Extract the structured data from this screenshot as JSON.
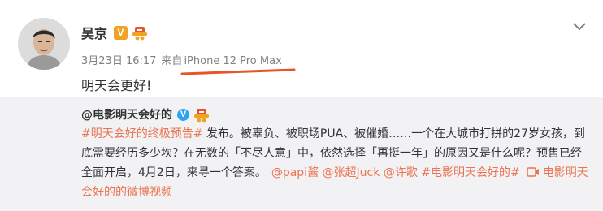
{
  "post": {
    "author": "吴京",
    "verified_badge": "V",
    "time": "3月23日 16:17",
    "source_prefix": "来自",
    "source": "iPhone 12 Pro Max",
    "text": "明天会更好!"
  },
  "repost": {
    "author": "@电影明天会好的",
    "verified_badge": "V",
    "hashtag": "#明天会好的终极预告#",
    "text_after_hashtag": " 发布。被辜负、被职场PUA、被催婚……一个在大城市打拼的27岁女孩，到底需要经历多少坎？在无数的「不尽人意」中，依然选择「再挺一年」的原因又是什么呢？预售已经全面开启，4月2日，来寻一个答案。",
    "mentions": [
      "@papi酱",
      "@张超Juck",
      "@许歌"
    ],
    "hashtag2": "#电影明天会好的#",
    "video_link": "电影明天会好的的微博视频"
  },
  "icons": {
    "chevron": "chevron-down-icon",
    "video": "video-icon",
    "hat": "hat-badge-icon"
  },
  "colors": {
    "link": "#eb7350",
    "orange_badge": "#f0a224",
    "blue_badge": "#2ea3f2",
    "underline": "#e8552a",
    "repost_bg": "#f2f2f5"
  }
}
